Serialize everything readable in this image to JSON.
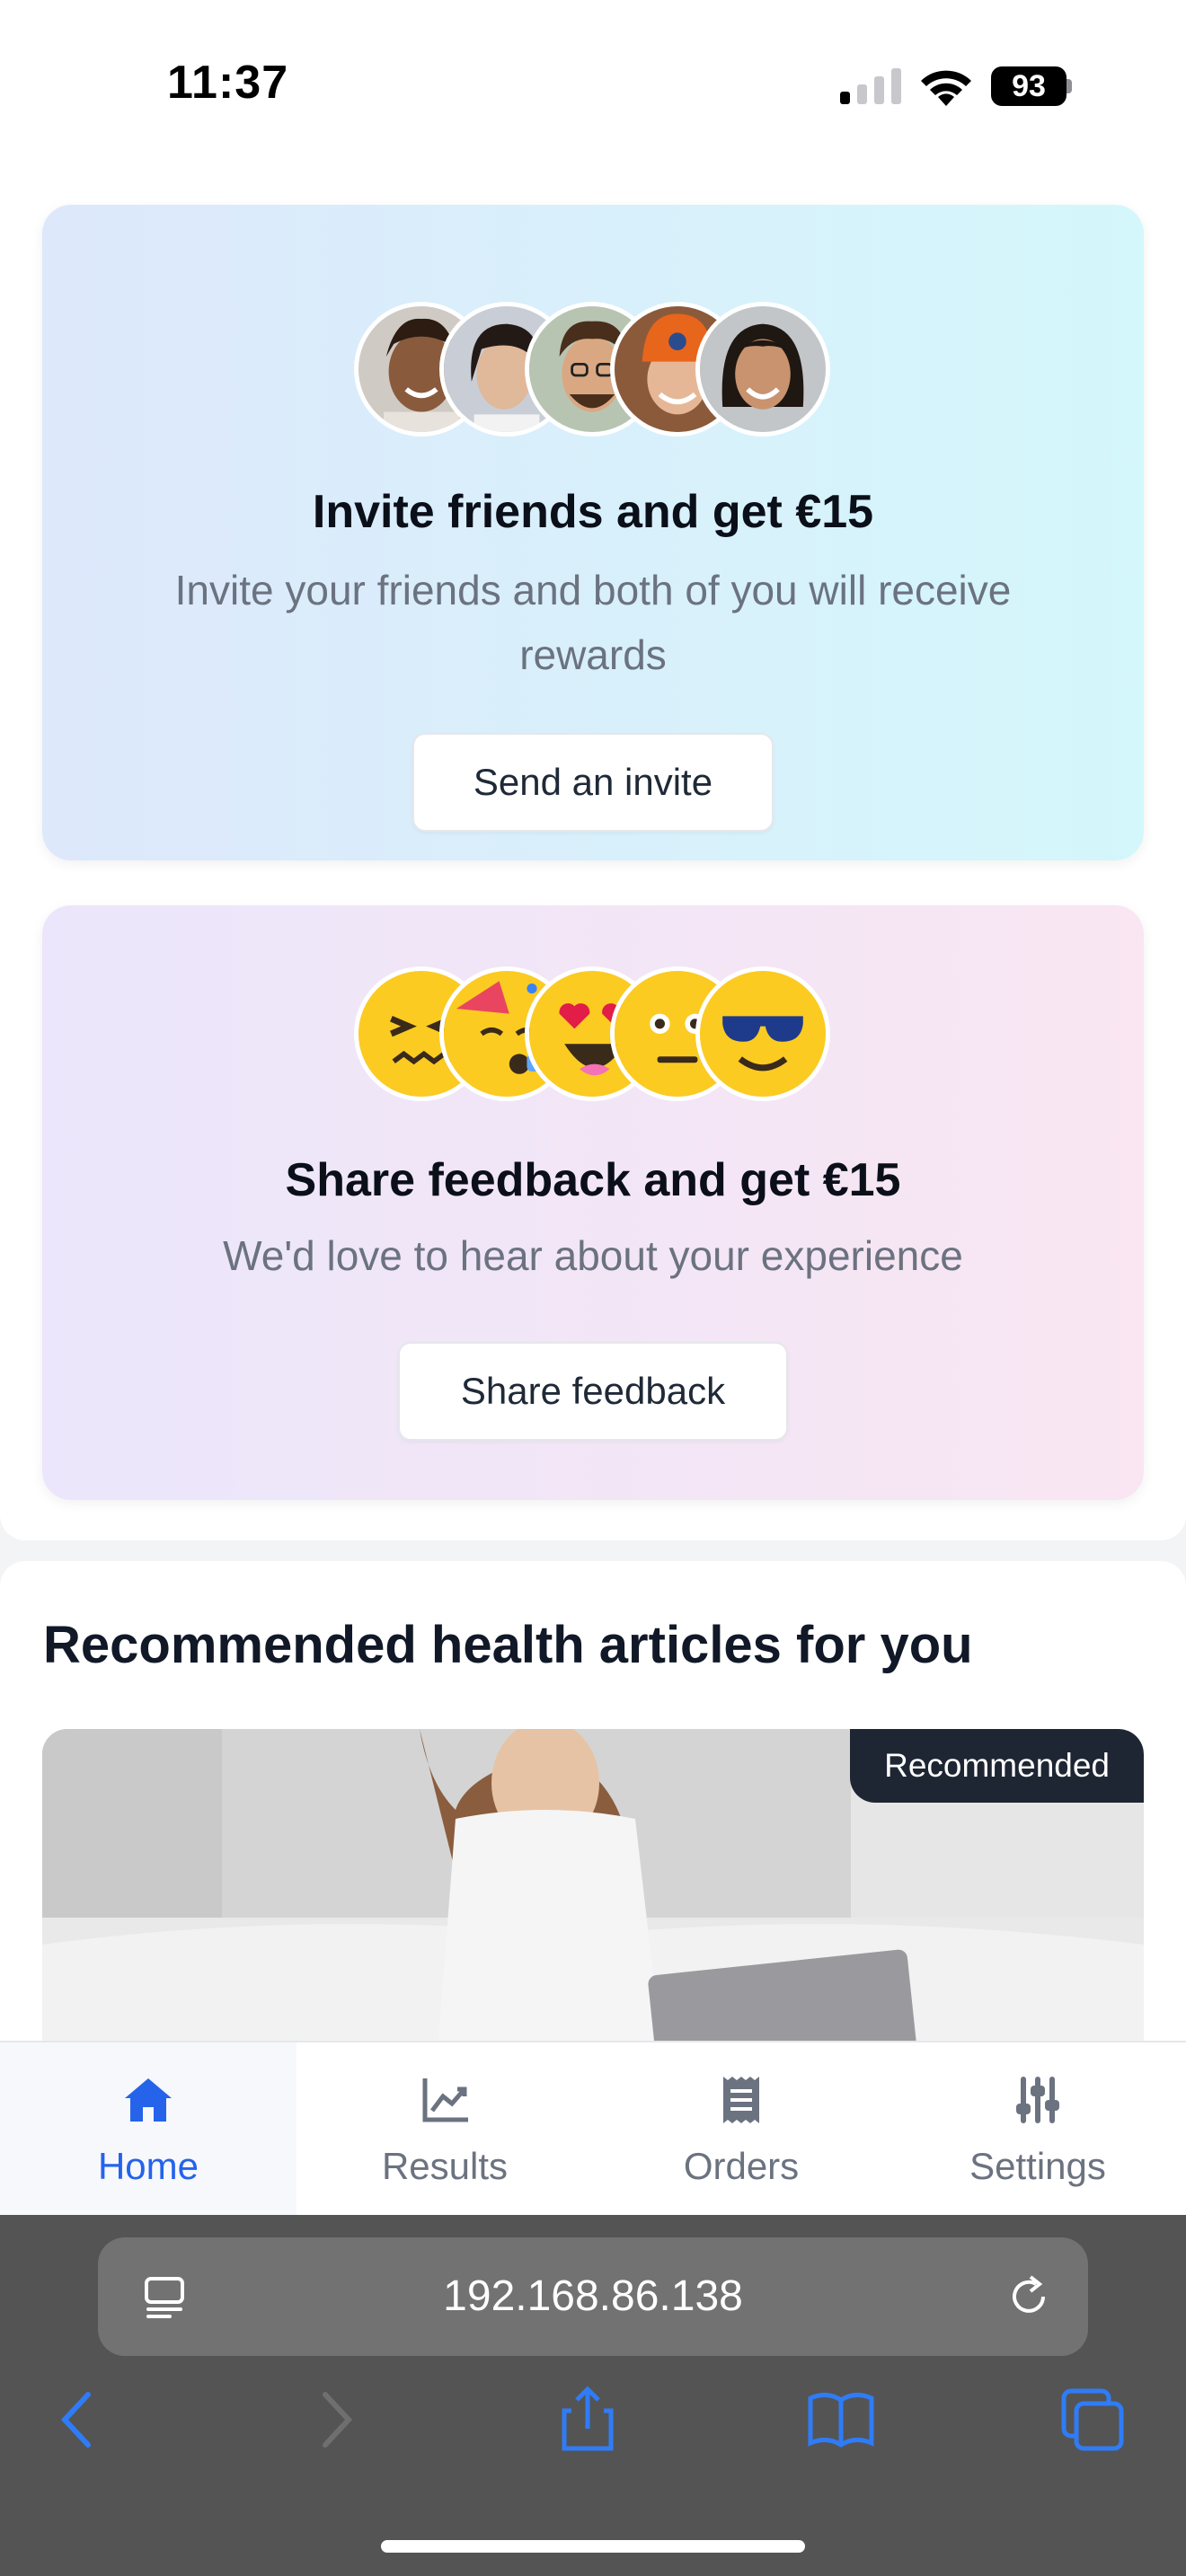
{
  "status_bar": {
    "time": "11:37",
    "battery": "93"
  },
  "invite_card": {
    "title": "Invite friends and get €15",
    "description": "Invite your friends and both of you will receive rewards",
    "button": "Send an invite"
  },
  "feedback_card": {
    "title": "Share feedback and get €15",
    "description": "We'd love to hear about your experience",
    "button": "Share feedback"
  },
  "articles": {
    "title": "Recommended health articles for you",
    "badge": "Recommended"
  },
  "tabs": [
    {
      "label": "Home",
      "icon": "home-icon",
      "active": true
    },
    {
      "label": "Results",
      "icon": "chart-icon",
      "active": false
    },
    {
      "label": "Orders",
      "icon": "receipt-icon",
      "active": false
    },
    {
      "label": "Settings",
      "icon": "sliders-icon",
      "active": false
    }
  ],
  "browser": {
    "url": "192.168.86.138"
  },
  "colors": {
    "accent": "#2563eb",
    "badge": "#1e2633",
    "muted": "#6b7280"
  }
}
